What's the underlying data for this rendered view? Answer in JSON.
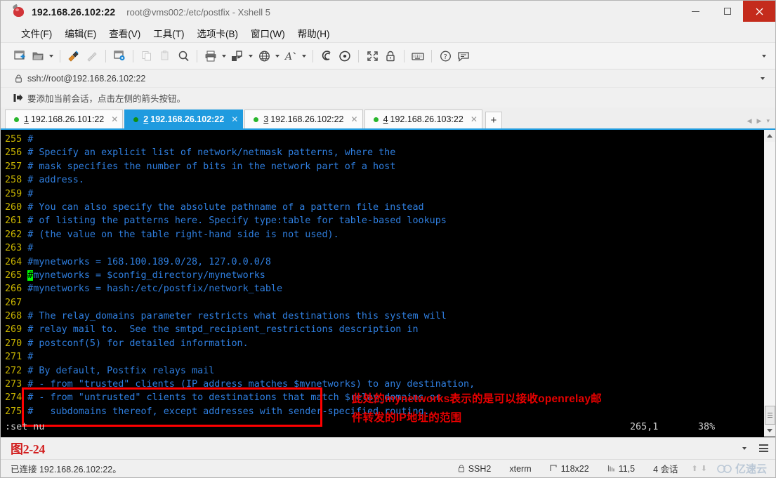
{
  "window": {
    "host_title": "192.168.26.102:22",
    "sub_title": "root@vms002:/etc/postfix - Xshell 5",
    "minimize": "–",
    "maximize": "□",
    "close": "✕"
  },
  "menu": [
    {
      "label": "文件(F)"
    },
    {
      "label": "编辑(E)"
    },
    {
      "label": "查看(V)"
    },
    {
      "label": "工具(T)"
    },
    {
      "label": "选项卡(B)"
    },
    {
      "label": "窗口(W)"
    },
    {
      "label": "帮助(H)"
    }
  ],
  "toolbar": {
    "icons": [
      "new-session-icon",
      "open-folder-icon",
      "dropdown-caret",
      "connect-icon",
      "disconnect-icon",
      "session-properties-icon",
      "copy-icon",
      "paste-icon",
      "find-icon",
      "print-icon",
      "dropdown-caret",
      "transfer-file-icon",
      "dropdown-caret",
      "encoding-globe-icon",
      "dropdown-caret",
      "font-icon",
      "dropdown-caret",
      "compose-bar-icon",
      "highlight-icon",
      "fullscreen-icon",
      "lock-icon",
      "keyboard-icon",
      "help-icon",
      "chat-icon"
    ],
    "overflow": "▾"
  },
  "address": {
    "lock_icon": "lock-icon",
    "url": "ssh://root@192.168.26.102:22",
    "caret": "▾"
  },
  "notice": {
    "icon": "add-session-arrow-icon",
    "text": "要添加当前会话，点击左侧的箭头按钮。"
  },
  "tabs": {
    "items": [
      {
        "num": "1",
        "label": "192.168.26.101:22",
        "active": false,
        "close": "✕"
      },
      {
        "num": "2",
        "label": "192.168.26.102:22",
        "active": true,
        "close": "✕"
      },
      {
        "num": "3",
        "label": "192.168.26.102:22",
        "active": false,
        "close": "✕"
      },
      {
        "num": "4",
        "label": "192.168.26.103:22",
        "active": false,
        "close": "✕"
      }
    ],
    "add_label": "+",
    "nav_prev": "◀",
    "nav_next": "▶",
    "nav_menu": "▾"
  },
  "terminal": {
    "lines": [
      {
        "n": "255",
        "text": "#"
      },
      {
        "n": "256",
        "text": "# Specify an explicit list of network/netmask patterns, where the"
      },
      {
        "n": "257",
        "text": "# mask specifies the number of bits in the network part of a host"
      },
      {
        "n": "258",
        "text": "# address."
      },
      {
        "n": "259",
        "text": "#"
      },
      {
        "n": "260",
        "text": "# You can also specify the absolute pathname of a pattern file instead"
      },
      {
        "n": "261",
        "text": "# of listing the patterns here. Specify type:table for table-based lookups"
      },
      {
        "n": "262",
        "text": "# (the value on the table right-hand side is not used)."
      },
      {
        "n": "263",
        "text": "#"
      },
      {
        "n": "264",
        "text": "#mynetworks = 168.100.189.0/28, 127.0.0.0/8"
      },
      {
        "n": "265",
        "text": "#mynetworks = $config_directory/mynetworks",
        "cursor_col": 0
      },
      {
        "n": "266",
        "text": "#mynetworks = hash:/etc/postfix/network_table"
      },
      {
        "n": "267",
        "text": ""
      },
      {
        "n": "268",
        "text": "# The relay_domains parameter restricts what destinations this system will"
      },
      {
        "n": "269",
        "text": "# relay mail to.  See the smtpd_recipient_restrictions description in"
      },
      {
        "n": "270",
        "text": "# postconf(5) for detailed information."
      },
      {
        "n": "271",
        "text": "#"
      },
      {
        "n": "272",
        "text": "# By default, Postfix relays mail"
      },
      {
        "n": "273",
        "text": "# - from \"trusted\" clients (IP address matches $mynetworks) to any destination,"
      },
      {
        "n": "274",
        "text": "# - from \"untrusted\" clients to destinations that match $relay_domains or"
      },
      {
        "n": "275",
        "text": "#   subdomains thereof, except addresses with sender-specified routing."
      }
    ],
    "vim_status": {
      "command": ":set nu",
      "position": "265,1",
      "percent": "38%"
    },
    "annotation_line1": "此处的mynetworks表示的是可以接收openrelay邮",
    "annotation_line2": "件转发的IP地址的范围",
    "highlight_color": "#ff0000",
    "annotation_color": "#e60000",
    "cursor_color": "#00ff00",
    "comment_color": "#2f7fe0",
    "linenumber_color": "#c8b400",
    "background_color": "#000000"
  },
  "figure": {
    "label": "图2-24",
    "caret": "▾",
    "menu_icon": "hamburger-icon"
  },
  "statusbar": {
    "connection": "已连接 192.168.26.102:22。",
    "protocol": "SSH2",
    "terminal_type": "xterm",
    "size": "118x22",
    "cursor_pos": "11,5",
    "sessions": "4 会话",
    "up_arrow": "⬆",
    "down_arrow": "⬇",
    "watermark": "亿速云"
  }
}
